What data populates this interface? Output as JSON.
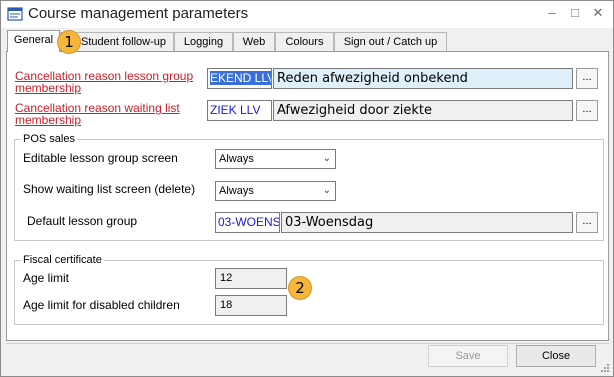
{
  "window": {
    "title": "Course management parameters"
  },
  "tabs": [
    {
      "label": "General"
    },
    {
      "label": "Student follow-up"
    },
    {
      "label": "Logging"
    },
    {
      "label": "Web"
    },
    {
      "label": "Colours"
    },
    {
      "label": "Sign out / Catch up"
    }
  ],
  "lesson_group": {
    "cancel_label": "Cancellation reason lesson group membership",
    "cancel_code": "EKEND LLV",
    "cancel_desc": "Reden afwezigheid onbekend",
    "waiting_label": "Cancellation reason waiting list membership",
    "waiting_code": "ZIEK LLV",
    "waiting_desc": "Afwezigheid door ziekte",
    "browse_label": "..."
  },
  "pos_sales": {
    "title": "POS sales",
    "editable_label": "Editable lesson group screen",
    "editable_value": "Always",
    "waiting_label": "Show waiting list screen (delete)",
    "waiting_value": "Always",
    "default_label": "Default lesson group",
    "default_code": "03-WOENS",
    "default_desc": "03-Woensdag",
    "browse_label": "..."
  },
  "fiscal": {
    "title": "Fiscal certificate",
    "age_label": "Age limit",
    "age_value": "12",
    "disabled_label": "Age limit for disabled children",
    "disabled_value": "18"
  },
  "footer": {
    "save_label": "Save",
    "close_label": "Close"
  },
  "callouts": [
    "1",
    "2"
  ],
  "colors": {
    "link_red": "#c8202a",
    "callout_orange": "#f5b63a",
    "code_blue": "#1a1ad0"
  }
}
